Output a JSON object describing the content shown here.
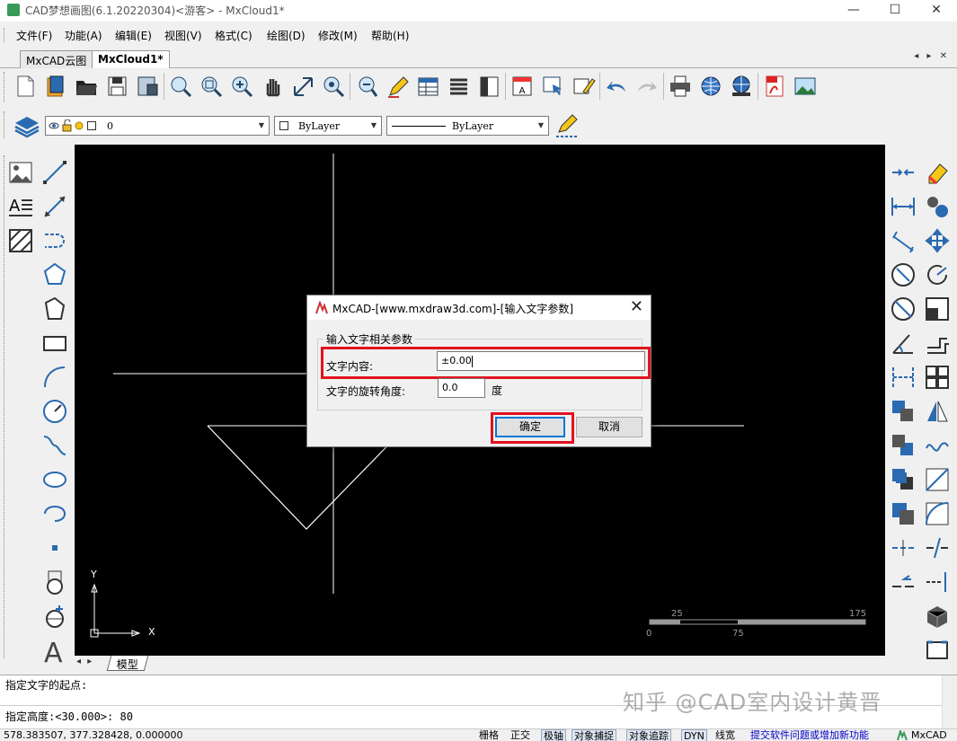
{
  "window": {
    "title": "CAD梦想画图(6.1.20220304)<游客> - MxCloud1*",
    "minimize": "—",
    "maximize": "☐",
    "close": "✕"
  },
  "menu": [
    "文件(F)",
    "功能(A)",
    "编辑(E)",
    "视图(V)",
    "格式(C)",
    "绘图(D)",
    "修改(M)",
    "帮助(H)"
  ],
  "tabs": [
    "MxCAD云图",
    "MxCloud1*"
  ],
  "tab_nav": "◂ ▸ ✕",
  "layer_toolbar": {
    "layer_value": "0",
    "color_value": "ByLayer",
    "linetype_value": "ByLayer"
  },
  "canvas": {
    "axis_y_label": "Y",
    "axis_x_label": "X",
    "scale_labels": [
      "25",
      "175",
      "0",
      "75"
    ]
  },
  "dialog": {
    "title": "MxCAD-[www.mxdraw3d.com]-[输入文字参数]",
    "close": "✕",
    "group_title": "输入文字相关参数",
    "content_label": "文字内容:",
    "content_value": "±0.00",
    "rotation_label": "文字的旋转角度:",
    "rotation_value": "0.0",
    "rotation_unit": "度",
    "ok_label": "确定",
    "cancel_label": "取消"
  },
  "layout_tabs": {
    "nav": "◂ ▸",
    "model_tab": "模型"
  },
  "command_lines": [
    "指定文字的起点:",
    "",
    "指定高度:<30.000>: 80"
  ],
  "statusbar": {
    "coords": "578.383507,  377.328428,  0.000000",
    "toggles": [
      "栅格",
      "正交",
      "极轴",
      "对象捕捉",
      "对象追踪",
      "DYN",
      "线宽"
    ],
    "link": "提交软件问题或增加新功能",
    "brand": "MxCAD"
  },
  "watermark": "知乎 @CAD室内设计黄晋",
  "colors": {
    "highlight": "#e0141e",
    "canvas_bg": "#000000",
    "link": "#0000cc"
  }
}
